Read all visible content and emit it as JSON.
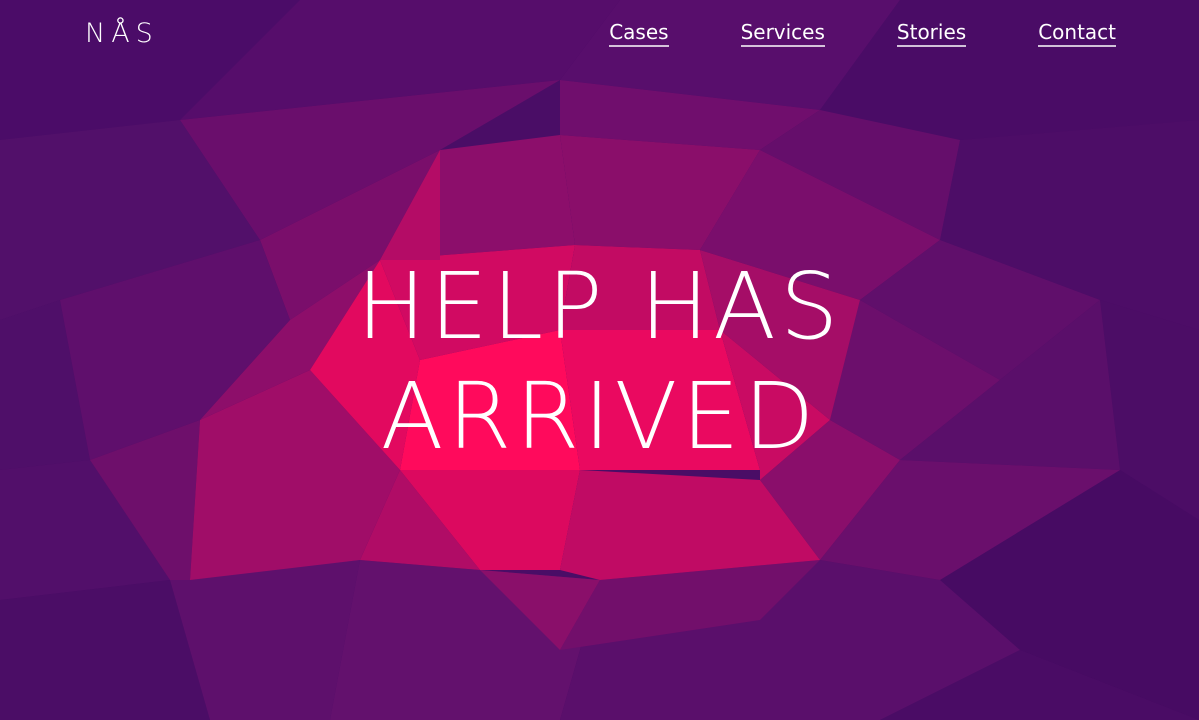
{
  "header": {
    "logo": "NÅS",
    "nav": [
      {
        "label": "Cases"
      },
      {
        "label": "Services"
      },
      {
        "label": "Stories"
      },
      {
        "label": "Contact"
      }
    ]
  },
  "hero": {
    "line1": "HELP HAS",
    "line2": "ARRIVED"
  },
  "colors": {
    "background": "#4a0d66",
    "accent": "#ff0a5c",
    "text": "#ffffff"
  }
}
